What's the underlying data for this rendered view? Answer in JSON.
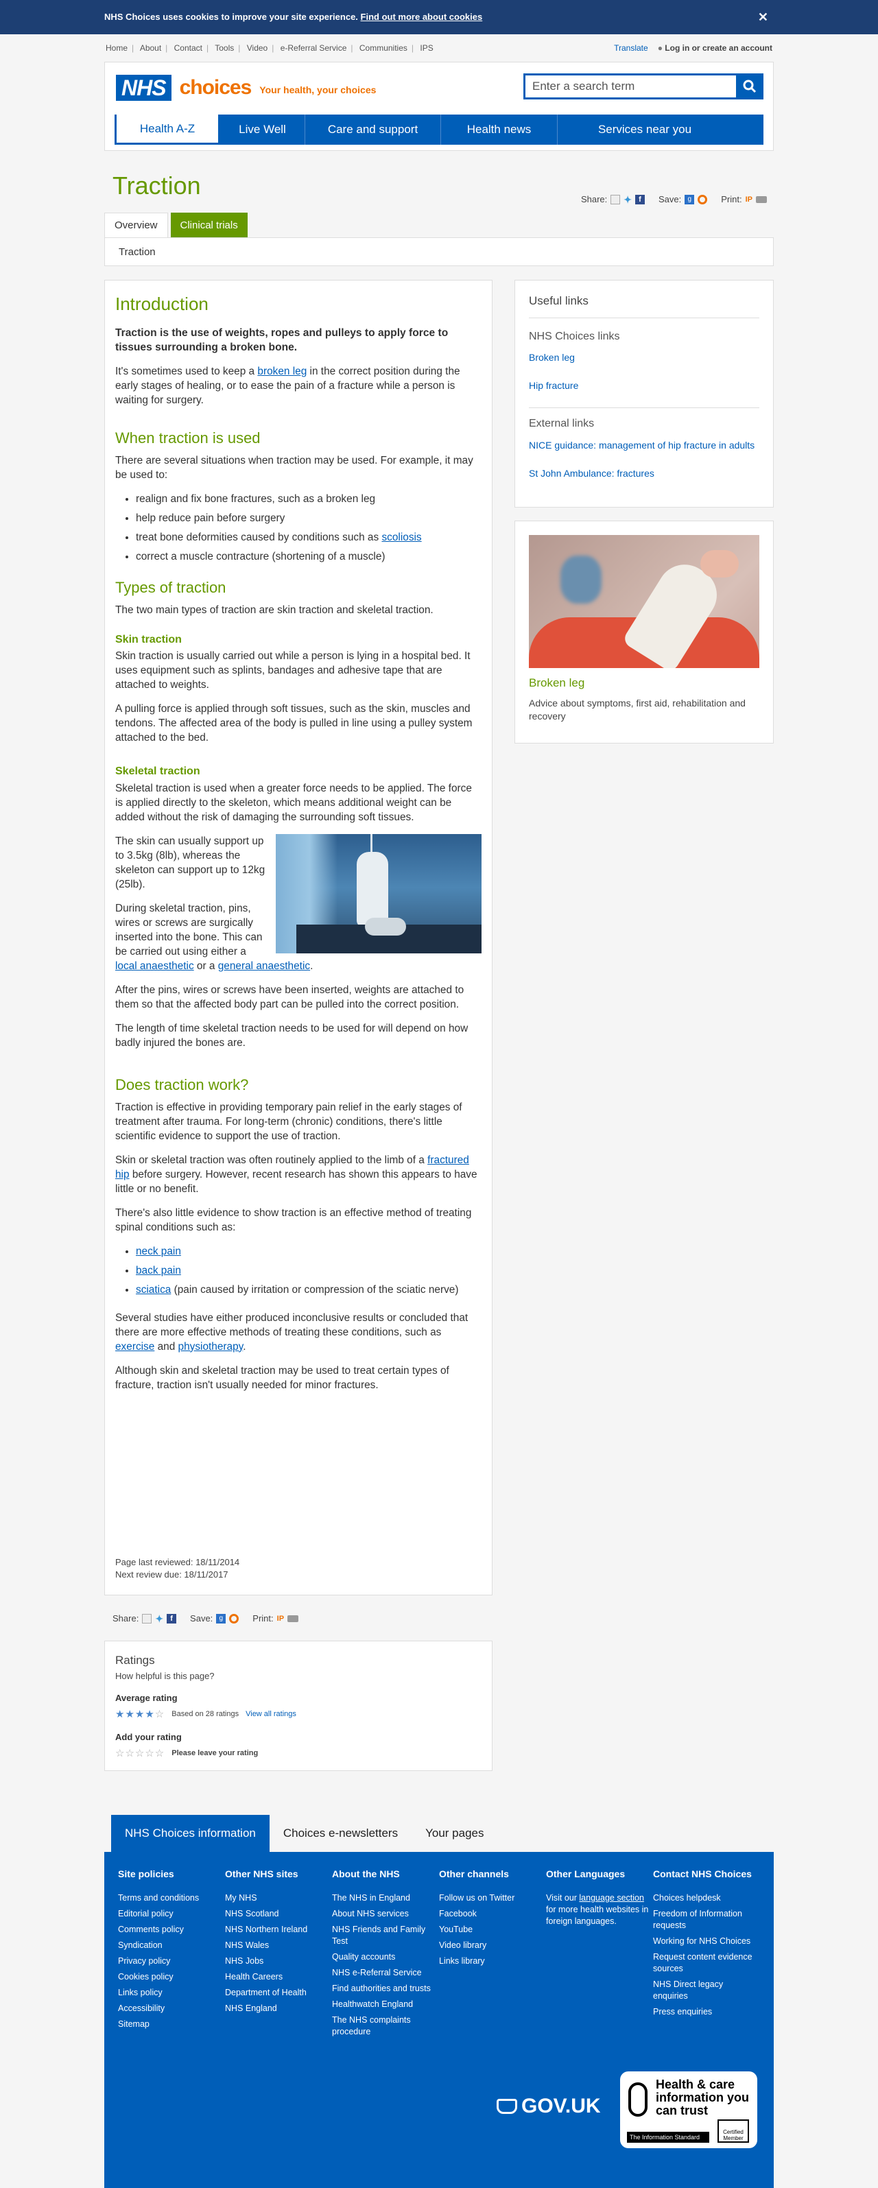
{
  "cookie": {
    "text": "NHS Choices uses cookies to improve your site experience.",
    "link": "Find out more about cookies",
    "close": "✕"
  },
  "util": {
    "items": [
      "Home",
      "About",
      "Contact",
      "Tools",
      "Video",
      "e-Referral Service",
      "Communities",
      "IPS"
    ],
    "translate": "Translate",
    "login": "Log in or",
    "create": "create an account"
  },
  "header": {
    "nhs": "NHS",
    "choices": "choices",
    "tagline": "Your health, your choices",
    "search_placeholder": "Enter a search term"
  },
  "nav": [
    "Health A-Z",
    "Live Well",
    "Care and support",
    "Health news",
    "Services near you"
  ],
  "page": {
    "title": "Traction"
  },
  "share": {
    "share": "Share:",
    "save": "Save:",
    "print": "Print:"
  },
  "tabs": {
    "overview": "Overview",
    "trials": "Clinical trials"
  },
  "breadcrumb": "Traction",
  "article": {
    "h_intro": "Introduction",
    "lead": "Traction is the use of weights, ropes and pulleys to apply force to tissues surrounding a broken bone.",
    "p1a": "It's sometimes used to keep a ",
    "p1link": "broken leg",
    "p1b": " in the correct position during the early stages of healing, or to ease the pain of a fracture while a person is waiting for surgery.",
    "h_when": "When traction is used",
    "p2": "There are several situations when traction may be used. For example, it may be used to:",
    "list1": [
      "realign and fix bone fractures, such as a broken leg",
      "help reduce pain before surgery",
      "treat bone deformities caused by conditions such as ",
      "correct a muscle contracture (shortening of a muscle)"
    ],
    "scoliosis": "scoliosis",
    "h_types": "Types of traction",
    "p3": "The two main types of traction are skin traction and skeletal traction.",
    "h_skin": "Skin traction",
    "p4": "Skin traction is usually carried out while a person is lying in a hospital bed. It uses equipment such as splints, bandages and adhesive tape that are attached to weights.",
    "p5": "A pulling force is applied through soft tissues, such as the skin, muscles and tendons. The affected area of the body is pulled in line using a pulley system attached to the bed.",
    "h_skel": "Skeletal traction",
    "p6": "Skeletal traction is used when a greater force needs to be applied. The force is applied directly to the skeleton, which means additional weight can be added without the risk of damaging the surrounding soft tissues.",
    "p7": "The skin can usually support up to 3.5kg (8lb), whereas the skeleton can support up to 12kg (25lb).",
    "p8a": "During skeletal traction, pins, wires or screws are surgically inserted into the bone. This can be carried out using either a ",
    "p8l1": "local anaesthetic",
    "p8m": " or a ",
    "p8l2": "general anaesthetic",
    "p8b": ".",
    "p9": "After the pins, wires or screws have been inserted, weights are attached to them so that the affected body part can be pulled into the correct position.",
    "p10": "The length of time skeletal traction needs to be used for will depend on how badly injured the bones are.",
    "h_work": "Does traction work?",
    "p11": "Traction is effective in providing temporary pain relief in the early stages of treatment after trauma. For long-term (chronic) conditions, there's little scientific evidence to support the use of traction.",
    "p12a": "Skin or skeletal traction was often routinely applied to the limb of a ",
    "p12l": "fractured hip",
    "p12b": " before surgery. However, recent research has shown this appears to have little or no benefit.",
    "p13": "There's also little evidence to show traction is an effective method of treating spinal conditions such as:",
    "list2": [
      "neck pain",
      "back pain",
      "sciatica"
    ],
    "sciatica_note": " (pain caused by irritation or compression of the sciatic nerve)",
    "p14a": "Several studies have either produced inconclusive results or concluded that there are more effective methods of treating these conditions, such as ",
    "p14l1": "exercise",
    "p14m": " and ",
    "p14l2": "physiotherapy",
    "p14b": ".",
    "p15": "Although skin and skeletal traction may be used to treat certain types of fracture, traction isn't usually needed for minor fractures.",
    "reviewed": "Page last reviewed: 18/11/2014",
    "next": "Next review due: 18/11/2017"
  },
  "sidebar": {
    "useful": "Useful links",
    "nhs_links": "NHS Choices links",
    "links1": [
      "Broken leg",
      "Hip fracture"
    ],
    "external": "External links",
    "links2": [
      "NICE guidance: management of hip fracture in adults",
      "St John Ambulance: fractures"
    ],
    "card_title": "Broken leg",
    "card_desc": "Advice about symptoms, first aid, rehabilitation and recovery"
  },
  "ratings": {
    "title": "Ratings",
    "question": "How helpful is this page?",
    "avg_label": "Average rating",
    "avg_value": 4,
    "based": "Based on 28 ratings",
    "view_all": "View all ratings",
    "add": "Add your rating",
    "leave": "Please leave your rating"
  },
  "footer": {
    "tabs": [
      "NHS Choices information",
      "Choices e-newsletters",
      "Your pages"
    ],
    "cols": [
      {
        "title": "Site policies",
        "items": [
          "Terms and conditions",
          "Editorial policy",
          "Comments policy",
          "Syndication",
          "Privacy policy",
          "Cookies policy",
          "Links policy",
          "Accessibility",
          "Sitemap"
        ]
      },
      {
        "title": "Other NHS sites",
        "items": [
          "My NHS",
          "NHS Scotland",
          "NHS Northern Ireland",
          "NHS Wales",
          "NHS Jobs",
          "Health Careers",
          "Department of Health",
          "NHS England"
        ]
      },
      {
        "title": "About the NHS",
        "items": [
          "The NHS in England",
          "About NHS services",
          "NHS Friends and Family Test",
          "Quality accounts",
          "NHS e-Referral Service",
          "Find authorities and trusts",
          "Healthwatch England",
          "The NHS complaints procedure"
        ]
      },
      {
        "title": "Other channels",
        "items": [
          "Follow us on Twitter",
          "Facebook",
          "YouTube",
          "Video library",
          "Links library"
        ]
      },
      {
        "title": "Other Languages",
        "items": []
      },
      {
        "title": "Contact NHS Choices",
        "items": [
          "Choices helpdesk",
          "Freedom of Information requests",
          "Working for NHS Choices",
          "Request content evidence sources",
          "NHS Direct legacy enquiries",
          "Press enquiries"
        ]
      }
    ],
    "lang_a": "Visit our ",
    "lang_link": "language section",
    "lang_b": " for more health websites in foreign languages.",
    "gov": "GOV.UK",
    "infostd_title": "Health & care information you can trust",
    "infostd_bar": "The Information Standard",
    "infostd_badge": "Certified Member"
  },
  "colors": {
    "nhs_blue": "#005eb8",
    "green": "#669900",
    "orange": "#ee7203"
  }
}
